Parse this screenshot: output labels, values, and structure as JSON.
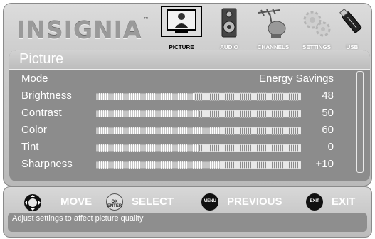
{
  "brand": {
    "logo_text": "INSIGNIA",
    "trademark": "™"
  },
  "tabs": [
    {
      "label": "PICTURE",
      "icon": "tv-icon",
      "active": true
    },
    {
      "label": "AUDIO",
      "icon": "speaker-icon",
      "active": false
    },
    {
      "label": "CHANNELS",
      "icon": "antenna-dish-icon",
      "active": false
    },
    {
      "label": "SETTINGS",
      "icon": "gears-icon",
      "active": false
    },
    {
      "label": "USB",
      "icon": "usb-drive-icon",
      "active": false
    }
  ],
  "panel": {
    "title": "Picture",
    "mode": {
      "label": "Mode",
      "value": "Energy Savings"
    },
    "sliders": [
      {
        "label": "Brightness",
        "value": "48",
        "level": 48
      },
      {
        "label": "Contrast",
        "value": "50",
        "level": 50
      },
      {
        "label": "Color",
        "value": "60",
        "level": 60
      },
      {
        "label": "Tint",
        "value": "0",
        "level": 50
      },
      {
        "label": "Sharpness",
        "value": "+10",
        "level": 60
      }
    ]
  },
  "controls": [
    {
      "icon": "dpad-icon",
      "badge": "",
      "label": "MOVE"
    },
    {
      "icon": "ok-enter-icon",
      "badge": "OK ENTER",
      "label": "SELECT"
    },
    {
      "icon": "menu-button-icon",
      "badge": "MENU",
      "label": "PREVIOUS"
    },
    {
      "icon": "exit-button-icon",
      "badge": "EXIT",
      "label": "EXIT"
    }
  ],
  "hint": "Adjust settings to affect picture quality",
  "colors": {
    "panel_bg": "#8c8c8c",
    "text": "#ffffff",
    "bar_fill": "#ffffff"
  }
}
